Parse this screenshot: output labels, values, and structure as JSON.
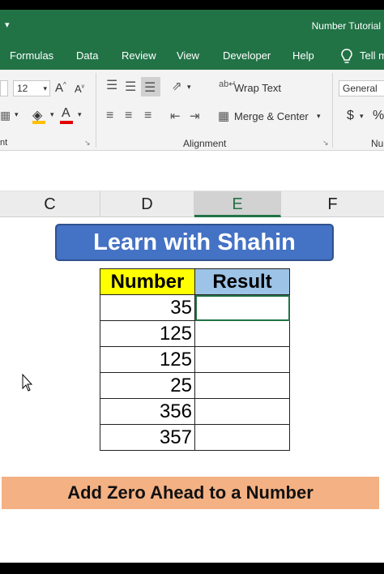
{
  "title_bar": {
    "document": "Number Tutorial"
  },
  "menu_tabs": [
    "Formulas",
    "Data",
    "Review",
    "View",
    "Developer",
    "Help",
    "Tell m"
  ],
  "ribbon": {
    "font_size": "12",
    "wrap_text": "Wrap Text",
    "merge_center": "Merge & Center",
    "number_format": "General",
    "alignment_label": "Alignment",
    "font_group_tail": "nt",
    "number_group_tail": "Nu",
    "currency": "$",
    "percent": "%"
  },
  "columns": [
    "C",
    "D",
    "E",
    "F"
  ],
  "selected_column": "E",
  "banner_title": "Learn with Shahin",
  "table": {
    "headers": [
      "Number",
      "Result"
    ],
    "rows": [
      {
        "number": "35",
        "result": ""
      },
      {
        "number": "125",
        "result": ""
      },
      {
        "number": "125",
        "result": ""
      },
      {
        "number": "25",
        "result": ""
      },
      {
        "number": "356",
        "result": ""
      },
      {
        "number": "357",
        "result": ""
      }
    ]
  },
  "footer_banner": "Add Zero Ahead to a Number",
  "colors": {
    "excel_green": "#217346",
    "header_yellow": "#ffff00",
    "header_blue": "#9dc3e6",
    "banner_blue": "#4472c4",
    "footer_orange": "#f4b183"
  }
}
